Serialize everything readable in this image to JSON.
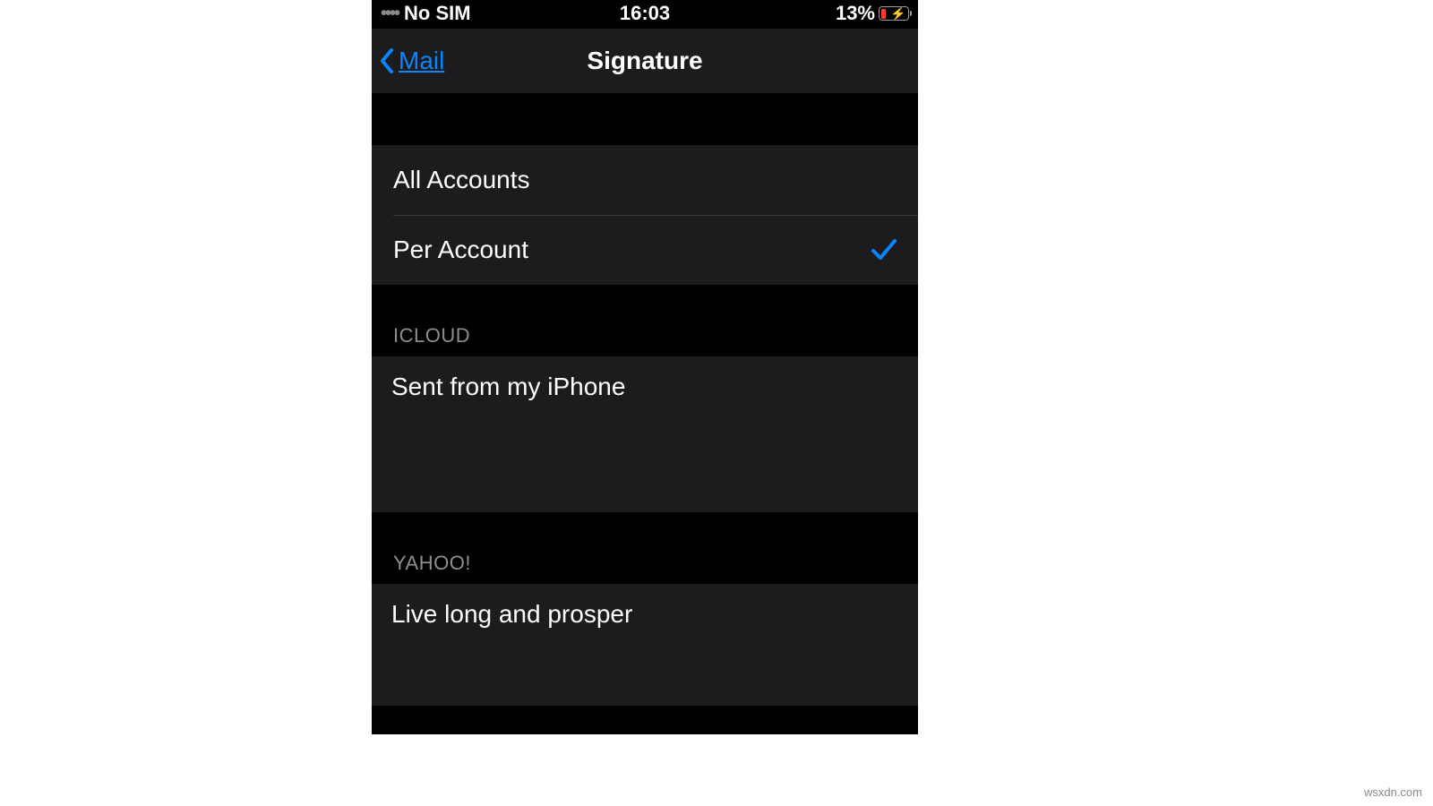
{
  "status_bar": {
    "carrier": "No SIM",
    "time": "16:03",
    "battery_pct": "13%"
  },
  "nav": {
    "back_label": "Mail",
    "title": "Signature"
  },
  "scope": {
    "all_label": "All Accounts",
    "per_label": "Per Account",
    "selected": "per"
  },
  "accounts": [
    {
      "header": "ICLOUD",
      "signature": "Sent from my iPhone"
    },
    {
      "header": "YAHOO!",
      "signature": "Live long and prosper"
    }
  ],
  "watermark": "wsxdn.com"
}
